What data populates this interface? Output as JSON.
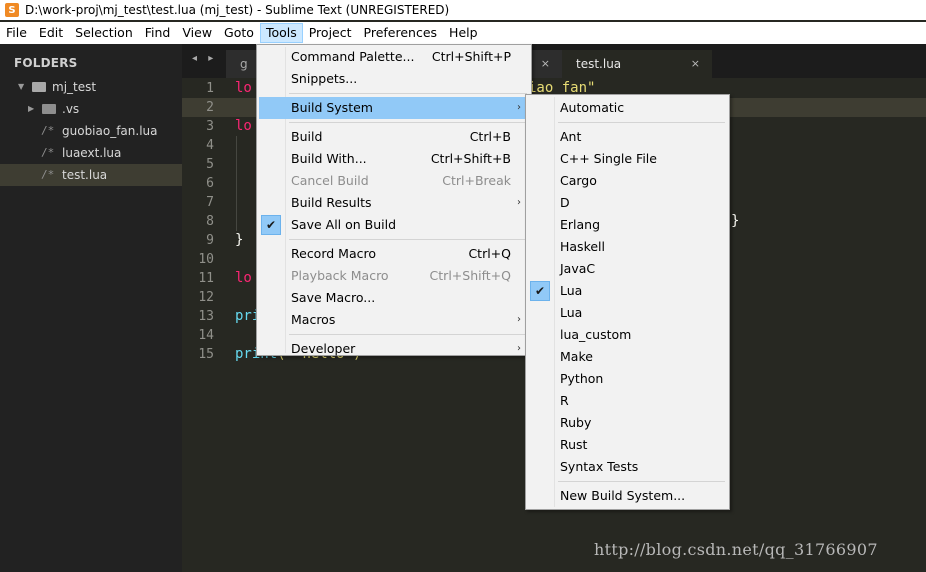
{
  "window": {
    "title": "D:\\work-proj\\mj_test\\test.lua (mj_test) - Sublime Text (UNREGISTERED)",
    "app_icon": "S"
  },
  "menubar": [
    "File",
    "Edit",
    "Selection",
    "Find",
    "View",
    "Goto",
    "Tools",
    "Project",
    "Preferences",
    "Help"
  ],
  "menubar_active": "Tools",
  "sidebar": {
    "heading": "FOLDERS",
    "tree": [
      {
        "name": "mj_test",
        "type": "folder-open"
      },
      {
        "name": ".vs",
        "type": "folder"
      },
      {
        "name": "guobiao_fan.lua",
        "type": "file"
      },
      {
        "name": "luaext.lua",
        "type": "file"
      },
      {
        "name": "test.lua",
        "type": "file",
        "selected": true
      }
    ]
  },
  "tabs": [
    {
      "label": "g",
      "active": false
    },
    {
      "label": "",
      "active": false
    },
    {
      "label": "test.lua",
      "active": true
    }
  ],
  "tab_nav": "◂ ▸",
  "tab_close": "×",
  "editor": {
    "line_numbers": [
      "1",
      "2",
      "3",
      "4",
      "5",
      "6",
      "7",
      "8",
      "9",
      "10",
      "11",
      "12",
      "13",
      "14",
      "15"
    ],
    "visible_fragments": {
      "l1_left": "lo",
      "l1_right": "iao_fan\"",
      "l3_left": "lo",
      "l8_right": "}",
      "l9": "}",
      "l11_left": "lo",
      "l13_left": "pri",
      "l15_fn": "print",
      "l15_rest": "( \"hello\")"
    }
  },
  "tools_menu": [
    {
      "label": "Command Palette...",
      "shortcut": "Ctrl+Shift+P"
    },
    {
      "label": "Snippets..."
    },
    {
      "separator": true
    },
    {
      "label": "Build System",
      "submenu": true,
      "hover": true
    },
    {
      "separator": true
    },
    {
      "label": "Build",
      "shortcut": "Ctrl+B"
    },
    {
      "label": "Build With...",
      "shortcut": "Ctrl+Shift+B"
    },
    {
      "label": "Cancel Build",
      "shortcut": "Ctrl+Break",
      "disabled": true
    },
    {
      "label": "Build Results",
      "submenu": true
    },
    {
      "label": "Save All on Build",
      "checked": true
    },
    {
      "separator": true
    },
    {
      "label": "Record Macro",
      "shortcut": "Ctrl+Q"
    },
    {
      "label": "Playback Macro",
      "shortcut": "Ctrl+Shift+Q",
      "disabled": true
    },
    {
      "label": "Save Macro..."
    },
    {
      "label": "Macros",
      "submenu": true
    },
    {
      "separator": true
    },
    {
      "label": "Developer",
      "submenu": true
    }
  ],
  "build_system_menu": [
    {
      "label": "Automatic"
    },
    {
      "separator": true
    },
    {
      "label": "Ant"
    },
    {
      "label": "C++ Single File"
    },
    {
      "label": "Cargo"
    },
    {
      "label": "D"
    },
    {
      "label": "Erlang"
    },
    {
      "label": "Haskell"
    },
    {
      "label": "JavaC"
    },
    {
      "label": "Lua",
      "checked": true
    },
    {
      "label": "Lua"
    },
    {
      "label": "lua_custom"
    },
    {
      "label": "Make"
    },
    {
      "label": "Python"
    },
    {
      "label": "R"
    },
    {
      "label": "Ruby"
    },
    {
      "label": "Rust"
    },
    {
      "label": "Syntax Tests"
    },
    {
      "separator": true
    },
    {
      "label": "New Build System..."
    }
  ],
  "glyphs": {
    "check": "✔",
    "submenu_arrow": "›",
    "tree_open": "▼",
    "tree_closed": "▶",
    "file": "/*"
  },
  "watermark": "http://blog.csdn.net/qq_31766907",
  "colors": {
    "editor_bg": "#272822",
    "sidebar_bg": "#222222",
    "menu_bg": "#f2f2f2",
    "menu_hover": "#91c9f7",
    "keyword": "#f92672",
    "string": "#e6db74",
    "function": "#66d9ef"
  }
}
